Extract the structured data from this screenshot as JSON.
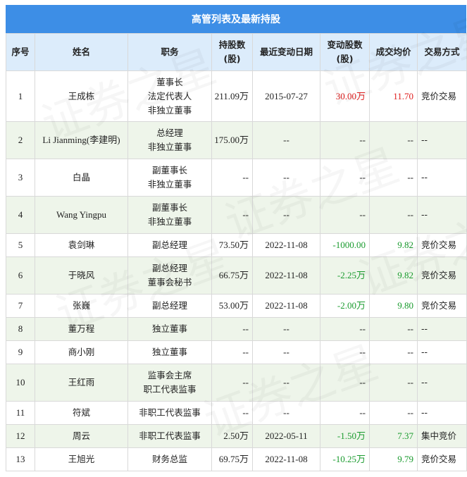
{
  "title": "高管列表及最新持股",
  "columns": [
    "序号",
    "姓名",
    "职务",
    "持股数(股)",
    "最近变动日期",
    "变动股数(股)",
    "成交均价",
    "交易方式"
  ],
  "column_lines": [
    [
      "序号"
    ],
    [
      "姓名"
    ],
    [
      "职务"
    ],
    [
      "持股数",
      "(股)"
    ],
    [
      "最近变动日期"
    ],
    [
      "变动股数",
      "(股)"
    ],
    [
      "成交均价"
    ],
    [
      "交易方式"
    ]
  ],
  "rows": [
    {
      "no": "1",
      "name": "王成栋",
      "roles": [
        "董事长",
        "法定代表人",
        "非独立董事"
      ],
      "shares": "211.09万",
      "date": "2015-07-27",
      "change": "30.00万",
      "change_color": "red",
      "price": "11.70",
      "price_color": "red",
      "method": "竞价交易"
    },
    {
      "no": "2",
      "name": "Li Jianming(李建明)",
      "roles": [
        "总经理",
        "非独立董事"
      ],
      "shares": "175.00万",
      "date": "--",
      "change": "--",
      "change_color": "",
      "price": "--",
      "price_color": "",
      "method": "--"
    },
    {
      "no": "3",
      "name": "白晶",
      "roles": [
        "副董事长",
        "非独立董事"
      ],
      "shares": "--",
      "date": "--",
      "change": "--",
      "change_color": "",
      "price": "--",
      "price_color": "",
      "method": "--"
    },
    {
      "no": "4",
      "name": "Wang Yingpu",
      "roles": [
        "副董事长",
        "非独立董事"
      ],
      "shares": "--",
      "date": "--",
      "change": "--",
      "change_color": "",
      "price": "--",
      "price_color": "",
      "method": "--"
    },
    {
      "no": "5",
      "name": "袁剑琳",
      "roles": [
        "副总经理"
      ],
      "shares": "73.50万",
      "date": "2022-11-08",
      "change": "-1000.00",
      "change_color": "green",
      "price": "9.82",
      "price_color": "green",
      "method": "竞价交易"
    },
    {
      "no": "6",
      "name": "于晓风",
      "roles": [
        "副总经理",
        "董事会秘书"
      ],
      "shares": "66.75万",
      "date": "2022-11-08",
      "change": "-2.25万",
      "change_color": "green",
      "price": "9.82",
      "price_color": "green",
      "method": "竞价交易"
    },
    {
      "no": "7",
      "name": "张巍",
      "roles": [
        "副总经理"
      ],
      "shares": "53.00万",
      "date": "2022-11-08",
      "change": "-2.00万",
      "change_color": "green",
      "price": "9.80",
      "price_color": "green",
      "method": "竞价交易"
    },
    {
      "no": "8",
      "name": "董万程",
      "roles": [
        "独立董事"
      ],
      "shares": "--",
      "date": "--",
      "change": "--",
      "change_color": "",
      "price": "--",
      "price_color": "",
      "method": "--"
    },
    {
      "no": "9",
      "name": "商小刚",
      "roles": [
        "独立董事"
      ],
      "shares": "--",
      "date": "--",
      "change": "--",
      "change_color": "",
      "price": "--",
      "price_color": "",
      "method": "--"
    },
    {
      "no": "10",
      "name": "王红雨",
      "roles": [
        "监事会主席",
        "职工代表监事"
      ],
      "shares": "--",
      "date": "--",
      "change": "--",
      "change_color": "",
      "price": "--",
      "price_color": "",
      "method": "--"
    },
    {
      "no": "11",
      "name": "符斌",
      "roles": [
        "非职工代表监事"
      ],
      "shares": "--",
      "date": "--",
      "change": "--",
      "change_color": "",
      "price": "--",
      "price_color": "",
      "method": "--"
    },
    {
      "no": "12",
      "name": "周云",
      "roles": [
        "非职工代表监事"
      ],
      "shares": "2.50万",
      "date": "2022-05-11",
      "change": "-1.50万",
      "change_color": "green",
      "price": "7.37",
      "price_color": "green",
      "method": "集中竞价"
    },
    {
      "no": "13",
      "name": "王旭光",
      "roles": [
        "财务总监"
      ],
      "shares": "69.75万",
      "date": "2022-11-08",
      "change": "-10.25万",
      "change_color": "green",
      "price": "9.79",
      "price_color": "green",
      "method": "竞价交易"
    }
  ],
  "watermark": "证券之星",
  "colors": {
    "header_bar": "#3d8ee6",
    "header_row": "#dcecfb",
    "row_alt": "#eef5ea",
    "up": "#e02020",
    "down": "#1a9b2e"
  }
}
